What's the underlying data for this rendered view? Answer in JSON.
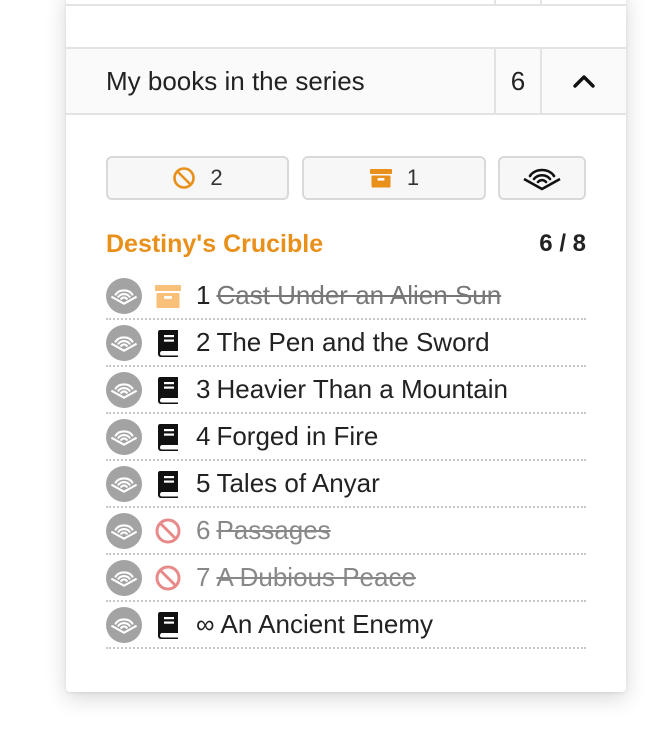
{
  "colors": {
    "accent": "#e8901a",
    "excluded_icon": "#e88a8a",
    "archived_icon": "#f9c07a",
    "audio_badge": "#a3a3a3"
  },
  "section": {
    "title": "My books in the series",
    "count": "6",
    "toggle_icon": "chevron-up-icon"
  },
  "filters": [
    {
      "icon": "block-icon",
      "label": "2"
    },
    {
      "icon": "archive-icon",
      "label": "1"
    },
    {
      "icon": "audible-icon",
      "label": ""
    }
  ],
  "series": {
    "name": "Destiny's Crucible",
    "progress": "6 / 8"
  },
  "books": [
    {
      "num": "1",
      "title": "Cast Under an Alien Sun",
      "status_icon": "archive-icon"
    },
    {
      "num": "2",
      "title": "The Pen and the Sword",
      "status_icon": "book-icon"
    },
    {
      "num": "3",
      "title": "Heavier Than a Mountain",
      "status_icon": "book-icon"
    },
    {
      "num": "4",
      "title": "Forged in Fire",
      "status_icon": "book-icon"
    },
    {
      "num": "5",
      "title": "Tales of Anyar",
      "status_icon": "book-icon"
    },
    {
      "num": "6",
      "title": "Passages",
      "status_icon": "block-icon"
    },
    {
      "num": "7",
      "title": "A Dubious Peace",
      "status_icon": "block-icon"
    },
    {
      "num": "∞",
      "title": "An Ancient Enemy",
      "status_icon": "book-icon"
    }
  ]
}
